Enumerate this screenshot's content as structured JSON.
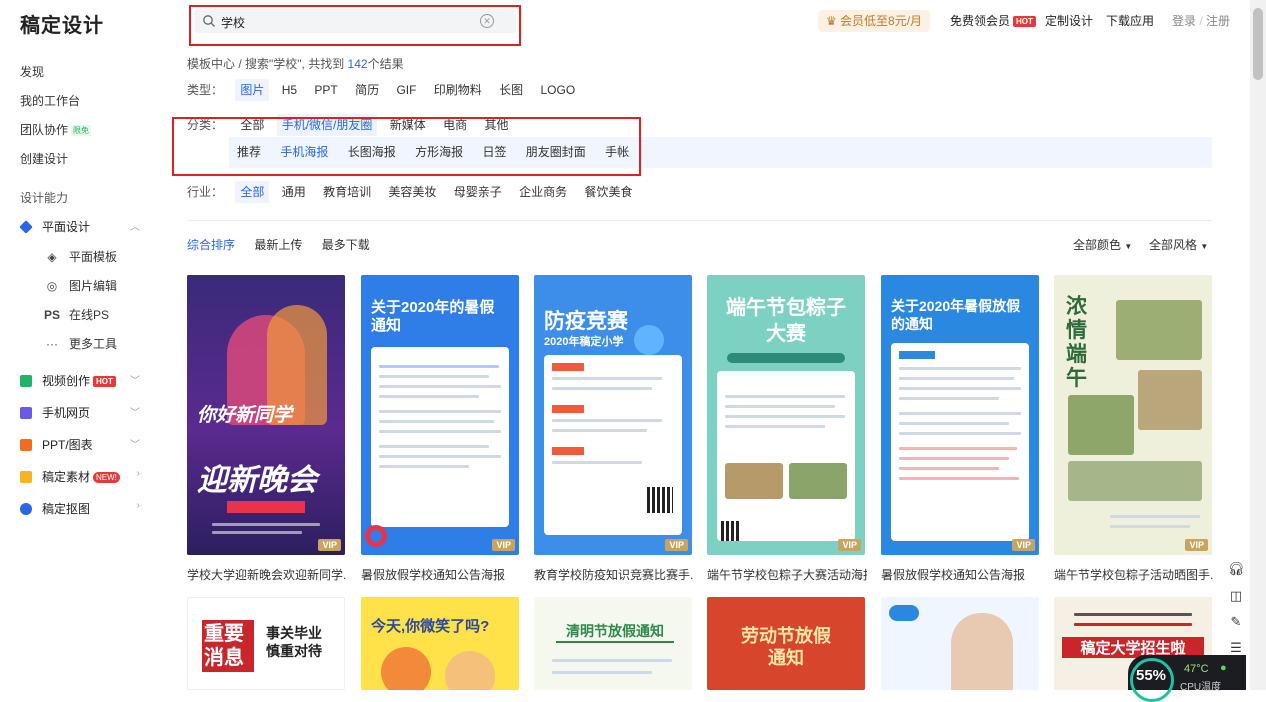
{
  "header": {
    "logo": "稿定设计",
    "search_value": "学校",
    "vip_promo": "会员低至8元/月",
    "free_vip": "免费领会员",
    "hot_tag": "HOT",
    "custom_design": "定制设计",
    "download_app": "下载应用",
    "login": "登录",
    "slash": "/",
    "register": "注册"
  },
  "sidebar": {
    "discover": "发现",
    "my_workspace": "我的工作台",
    "team": "团队协作",
    "team_tag": "限免",
    "create": "创建设计",
    "section_title": "设计能力",
    "graphic": "平面设计",
    "sub": [
      {
        "icon": "layers-icon",
        "label": "平面模板"
      },
      {
        "icon": "aperture-icon",
        "label": "图片编辑"
      },
      {
        "icon": "ps-icon",
        "label": "在线PS"
      },
      {
        "icon": "dots-icon",
        "label": "更多工具"
      }
    ],
    "video": "视频创作",
    "video_tag": "HOT",
    "mobile": "手机网页",
    "ppt": "PPT/图表",
    "assets": "稿定素材",
    "assets_tag": "NEW!",
    "cutout": "稿定抠图"
  },
  "breadcrumb": {
    "prefix": "模板中心 / 搜索\"学校\", 共找到",
    "count": "142",
    "suffix": "个结果"
  },
  "filters": {
    "type_label": "类型：",
    "types": [
      "图片",
      "H5",
      "PPT",
      "简历",
      "GIF",
      "印刷物料",
      "长图",
      "LOGO"
    ],
    "cat_label": "分类：",
    "cats": [
      "全部",
      "手机/微信/朋友圈",
      "新媒体",
      "电商",
      "其他"
    ],
    "subcats": [
      "推荐",
      "手机海报",
      "长图海报",
      "方形海报",
      "日签",
      "朋友圈封面",
      "手帐"
    ],
    "industry_label": "行业：",
    "industries": [
      "全部",
      "通用",
      "教育培训",
      "美容美妆",
      "母婴亲子",
      "企业商务",
      "餐饮美食"
    ]
  },
  "sort": {
    "options": [
      "综合排序",
      "最新上传",
      "最多下载"
    ],
    "all_colors": "全部颜色",
    "all_styles": "全部风格"
  },
  "cards": [
    {
      "caption": "学校大学迎新晚会欢迎新同学...",
      "title": "你好新同学",
      "subtitle": "迎新晚会",
      "vip": "VIP",
      "bg": "#3a2a7a"
    },
    {
      "caption": "暑假放假学校通知公告海报",
      "title": "关于2020年的暑假通知",
      "vip": "VIP",
      "bg": "#2f7de6"
    },
    {
      "caption": "教育学校防疫知识竞赛比赛手...",
      "title": "防疫竞赛",
      "subtitle": "2020年稿定小学",
      "vip": "VIP",
      "bg": "#3d8ee8"
    },
    {
      "caption": "端午节学校包粽子大赛活动海报",
      "title": "端午节包粽子大赛",
      "vip": "VIP",
      "bg": "#6bc7b8"
    },
    {
      "caption": "暑假放假学校通知公告海报",
      "title": "关于2020年暑假放假的通知",
      "vip": "VIP",
      "bg": "#2a88e0"
    },
    {
      "caption": "端午节学校包粽子活动晒图手...",
      "title": "浓情端午",
      "vip": "VIP",
      "bg": "#eef0dc"
    }
  ],
  "cards_row2": [
    {
      "title": "重要消息",
      "side": "事关毕业慎重对待",
      "bg": "#ffffff"
    },
    {
      "title": "今天,你微笑了吗?",
      "bg": "#ffe14a"
    },
    {
      "title": "清明节放假通知",
      "bg": "#f4f8ef"
    },
    {
      "title": "劳动节放假通知",
      "bg": "#d7462c"
    },
    {
      "title": "",
      "bg": "#f0f6ff"
    },
    {
      "title": "稿定大学招生啦",
      "bg": "#f6efe4"
    }
  ],
  "perf": {
    "cpu_percent": "55%",
    "temp": "47°C",
    "temp_label": "CPU温度"
  },
  "colors": {
    "accent": "#2a66e0",
    "highlight_box": "#e02020",
    "vip_gold": "#c9a45f"
  }
}
